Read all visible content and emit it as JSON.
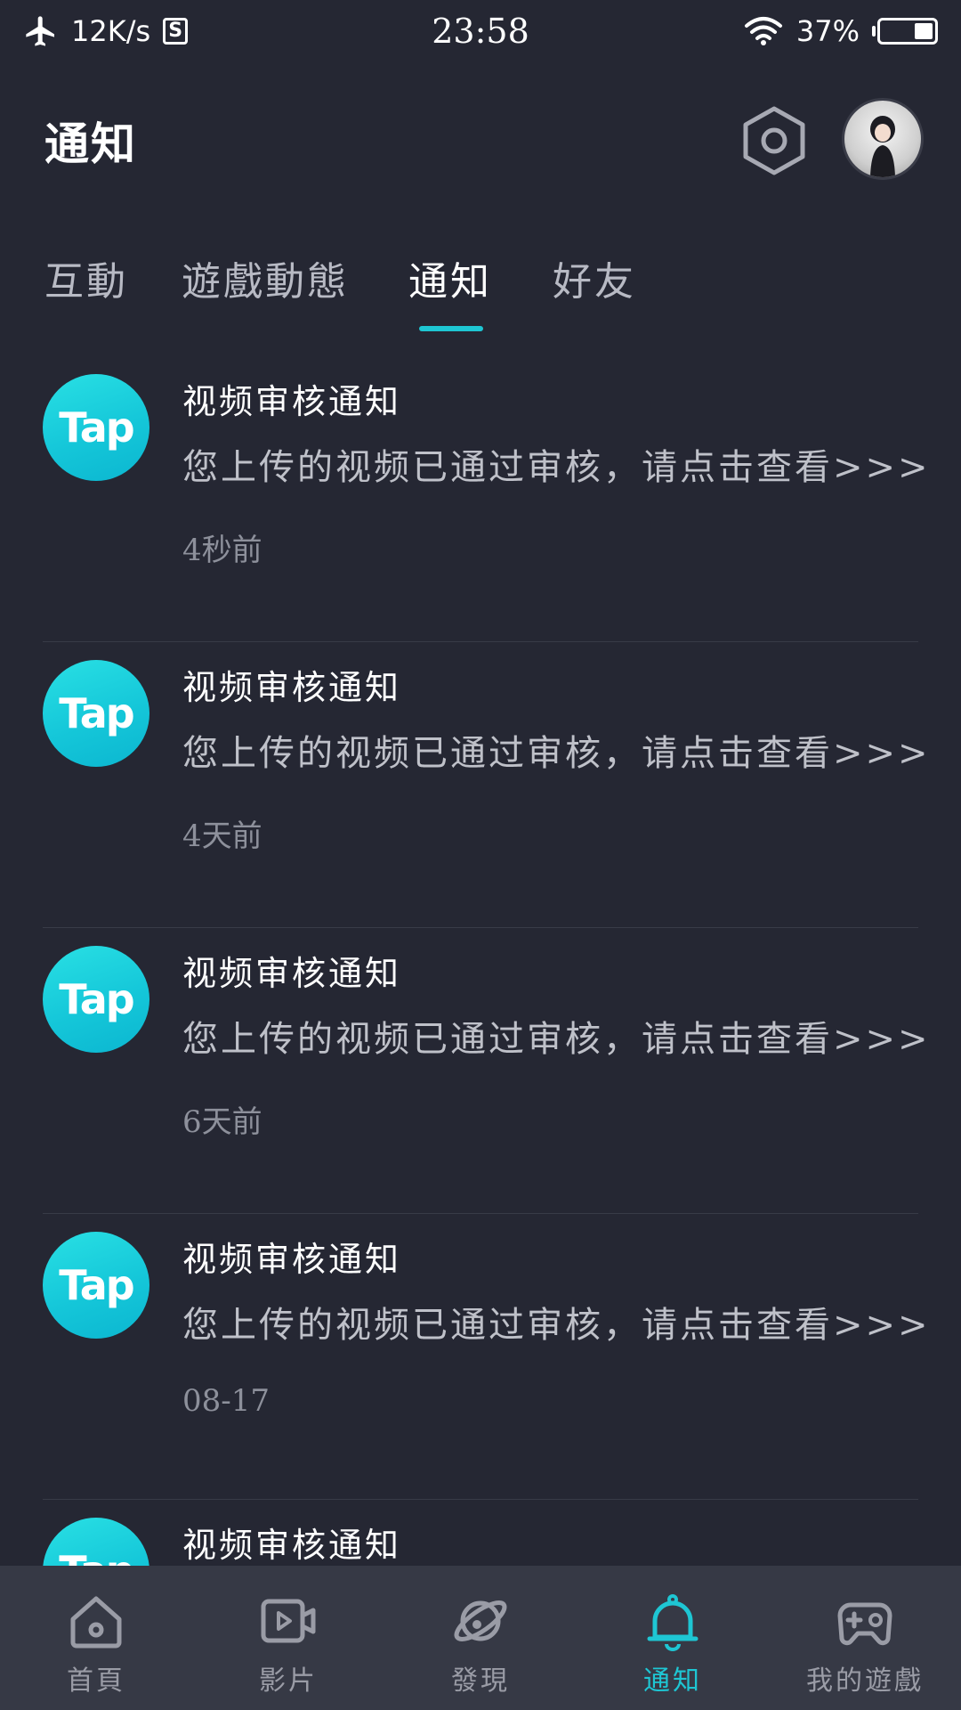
{
  "status_bar": {
    "net_speed": "12K/s",
    "sim_label": "S",
    "time": "23:58",
    "battery": "37%"
  },
  "header": {
    "title": "通知"
  },
  "tabs": [
    {
      "label": "互動"
    },
    {
      "label": "遊戲動態"
    },
    {
      "label": "通知"
    },
    {
      "label": "好友"
    }
  ],
  "notifications": [
    {
      "logo": "Tap",
      "title": "视频审核通知",
      "body": "您上传的视频已通过审核，请点击查看>>>",
      "time": "4秒前"
    },
    {
      "logo": "Tap",
      "title": "视频审核通知",
      "body": "您上传的视频已通过审核，请点击查看>>>",
      "time": "4天前"
    },
    {
      "logo": "Tap",
      "title": "视频审核通知",
      "body": "您上传的视频已通过审核，请点击查看>>>",
      "time": "6天前"
    },
    {
      "logo": "Tap",
      "title": "视频审核通知",
      "body": "您上传的视频已通过审核，请点击查看>>>",
      "time": "08-17"
    },
    {
      "logo": "Tap",
      "title": "视频审核通知",
      "body": "",
      "time": ""
    }
  ],
  "bottom_nav": [
    {
      "label": "首頁",
      "icon": "home-icon"
    },
    {
      "label": "影片",
      "icon": "video-icon"
    },
    {
      "label": "發現",
      "icon": "planet-icon"
    },
    {
      "label": "通知",
      "icon": "bell-icon"
    },
    {
      "label": "我的遊戲",
      "icon": "gamepad-icon"
    }
  ],
  "colors": {
    "background": "#252733",
    "accent": "#1ec6d3",
    "nav_background": "#363945"
  }
}
